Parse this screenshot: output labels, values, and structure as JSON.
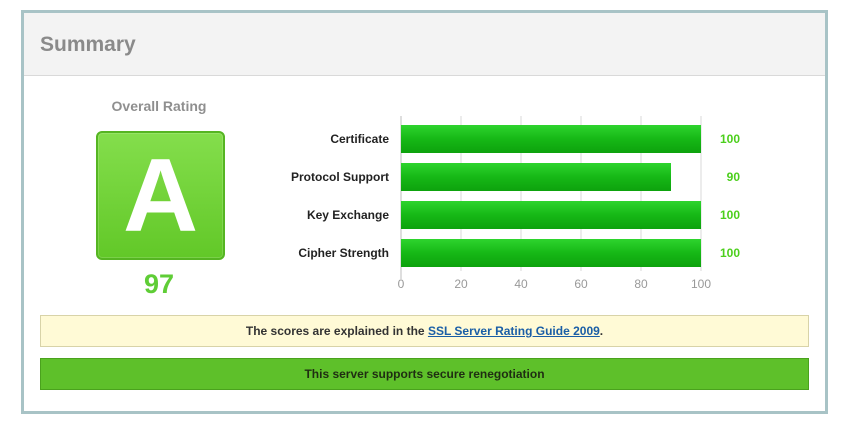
{
  "header": {
    "title": "Summary"
  },
  "overall": {
    "label": "Overall Rating",
    "grade": "A",
    "score": "97"
  },
  "colors": {
    "bar": "#1dbd1d",
    "value_text": "#4ccf1c",
    "grade_bg": "#72d33a"
  },
  "chart_data": {
    "type": "bar",
    "orientation": "horizontal",
    "categories": [
      "Certificate",
      "Protocol Support",
      "Key Exchange",
      "Cipher Strength"
    ],
    "values": [
      100,
      90,
      100,
      100
    ],
    "xlim": [
      0,
      100
    ],
    "xticks": [
      0,
      20,
      40,
      60,
      80,
      100
    ],
    "grid": true
  },
  "notice": {
    "prefix": "The scores are explained in the",
    "link_text": "SSL Server Rating Guide 2009",
    "suffix": "."
  },
  "renegotiation": {
    "text": "This server supports secure renegotiation"
  }
}
